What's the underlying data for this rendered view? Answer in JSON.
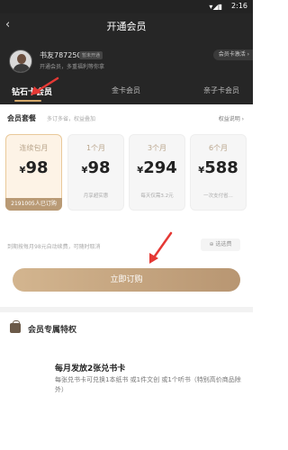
{
  "status_bar": {
    "time": "2:16",
    "signal": "▾◢▮"
  },
  "nav": {
    "back": "‹",
    "title": "开通会员"
  },
  "user": {
    "name": "书友78725022",
    "badge": "暂未开通",
    "subtitle": "开通会员，多重福利等你拿",
    "activate": "会员卡激活 ›"
  },
  "tabs": [
    "钻石卡会员",
    "金卡会员",
    "亲子卡会员"
  ],
  "packages": {
    "title": "会员套餐",
    "hint": "多订多省，权益叠加",
    "explain": "权益说明 ›"
  },
  "plans": [
    {
      "name": "连续包月",
      "currency": "¥",
      "price": "98",
      "note": "",
      "bought": "2191005人已订购"
    },
    {
      "name": "1个月",
      "currency": "¥",
      "price": "98",
      "note": "月享超实惠",
      "bought": ""
    },
    {
      "name": "3个月",
      "currency": "¥",
      "price": "294",
      "note": "每天仅需3.2元",
      "bought": ""
    },
    {
      "name": "6个月",
      "currency": "¥",
      "price": "588",
      "note": "一次支付省...",
      "bought": ""
    }
  ],
  "renew_note": "到期按每月98元自动续费，可随时取消",
  "coupon": "⊕ 选选费",
  "subscribe": "立即订购",
  "privileges": {
    "title": "会员专属特权",
    "benefit_title": "每月发放2张兑书卡",
    "benefit_desc": "每张兑书卡可兑换1本纸书 或1件文创 或1个听书（特别高价商品除外）"
  },
  "colors": {
    "accent": "#d4a86a",
    "selected_bg": "#fdf3e6",
    "arrow": "#e53935"
  }
}
